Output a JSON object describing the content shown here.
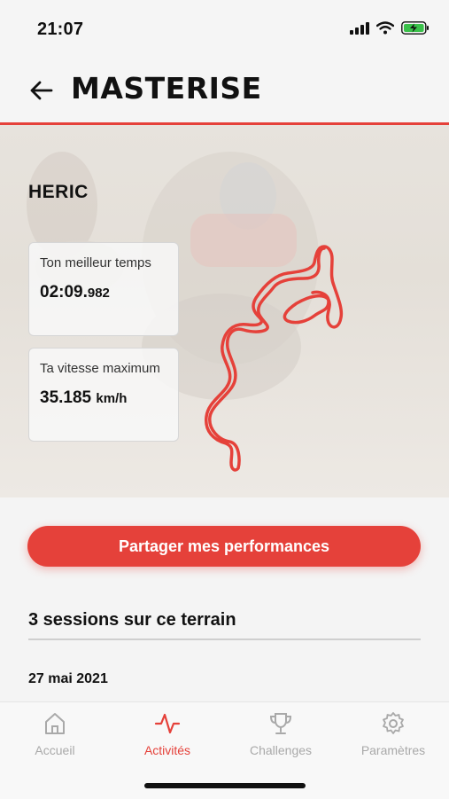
{
  "status_bar": {
    "time": "21:07"
  },
  "header": {
    "title": "MASTERISE"
  },
  "terrain": {
    "name": "HERIC"
  },
  "stats": {
    "best_time_label": "Ton meilleur temps",
    "best_time_main": "02:09.",
    "best_time_ms": "982",
    "max_speed_label": "Ta vitesse maximum",
    "max_speed_value": "35.185",
    "max_speed_unit": "km/h"
  },
  "share_button": {
    "label": "Partager mes performances"
  },
  "sessions": {
    "title": "3 sessions sur ce terrain",
    "first_date": "27 mai 2021"
  },
  "tabbar": {
    "tabs": [
      {
        "label": "Accueil",
        "icon": "home-icon",
        "active": false
      },
      {
        "label": "Activités",
        "icon": "activity-icon",
        "active": true
      },
      {
        "label": "Challenges",
        "icon": "trophy-icon",
        "active": false
      },
      {
        "label": "Paramètres",
        "icon": "gear-icon",
        "active": false
      }
    ]
  },
  "colors": {
    "accent": "#e5413a",
    "inactive": "#a9a9a9"
  }
}
